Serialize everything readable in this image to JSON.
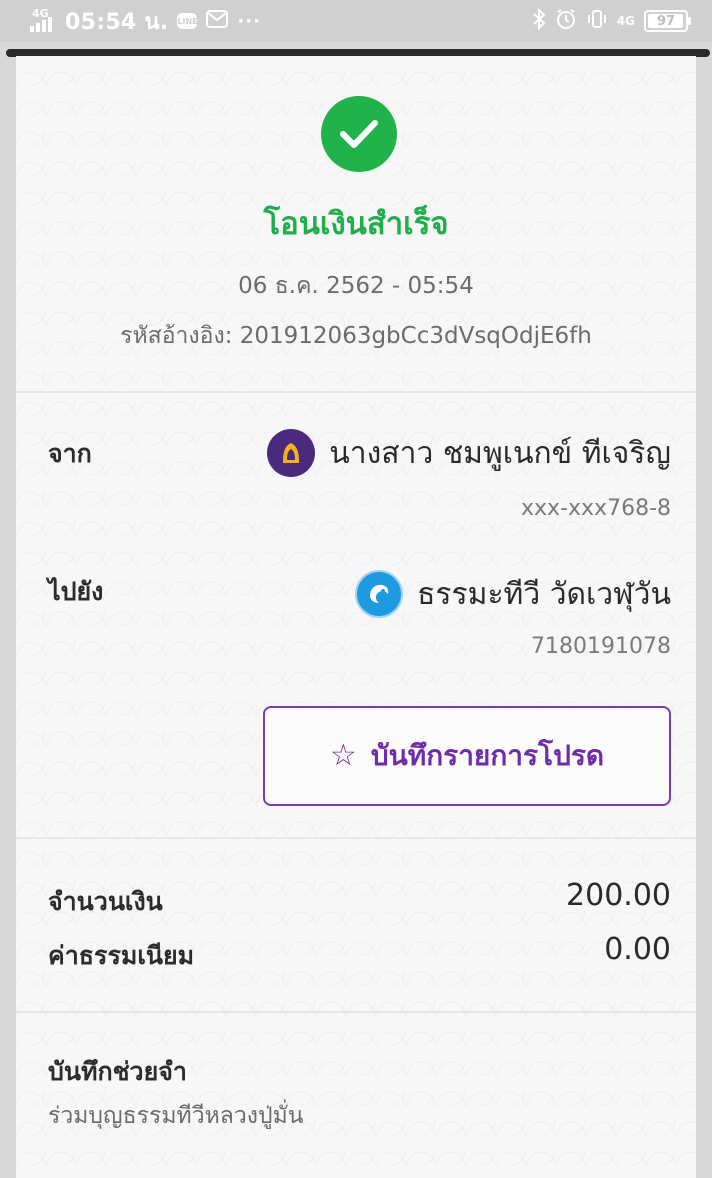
{
  "status_bar": {
    "network_left": "4G",
    "time": "05:54 น.",
    "app_icon": "LINE",
    "more": "···",
    "network_right": "4G",
    "battery": "97",
    "icons": [
      "signal-icon",
      "line-app-icon",
      "mail-icon",
      "bluetooth-icon",
      "alarm-icon",
      "vibrate-icon",
      "battery-icon"
    ]
  },
  "receipt": {
    "title": "โอนเงินสำเร็จ",
    "datetime": "06 ธ.ค. 2562 - 05:54",
    "reference": "รหัสอ้างอิง: 201912063gbCc3dVsqOdjE6fh"
  },
  "from": {
    "label": "จาก",
    "name": "นางสาว ชมพูเนกข์ ทีเจริญ",
    "account": "xxx-xxx768-8",
    "bank_icon": "gsb-bank-icon"
  },
  "to": {
    "label": "ไปยัง",
    "name": "ธรรมะทีวี  วัดเวฬุวัน",
    "account": "7180191078",
    "bank_icon": "ktb-bank-icon"
  },
  "favorite_button": {
    "label": "บันทึกรายการโปรด",
    "icon": "star-icon"
  },
  "amount": {
    "label": "จำนวนเงิน",
    "value": "200.00"
  },
  "fee": {
    "label": "ค่าธรรมเนียม",
    "value": "0.00"
  },
  "memo": {
    "label": "บันทึกช่วยจำ",
    "value": "ร่วมบุญธรรมทีวีหลวงปู่มั่น"
  },
  "colors": {
    "success_green": "#22b24c",
    "accent_purple": "#7b3bb3",
    "gsb_purple": "#4a2a7c",
    "ktb_blue": "#1e9be0",
    "status_bar": "#d0d0d0"
  }
}
